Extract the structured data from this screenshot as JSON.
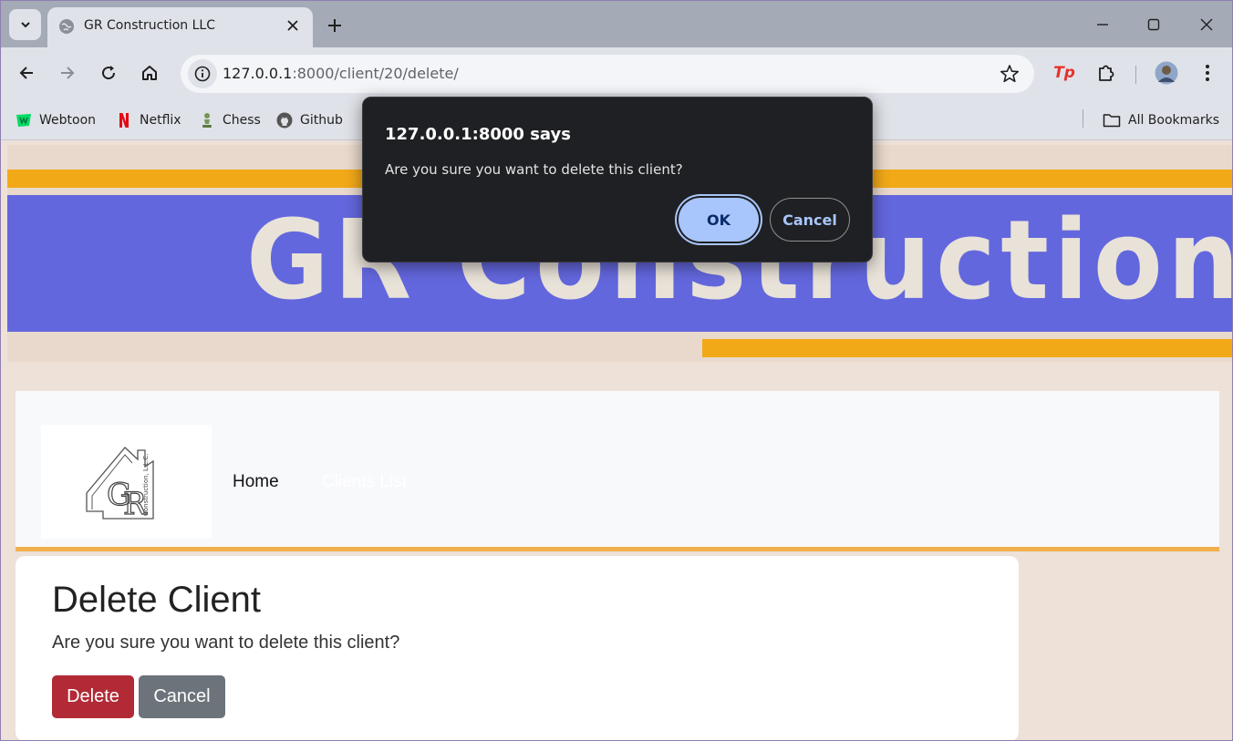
{
  "browser": {
    "tab_title": "GR Construction LLC",
    "url_host": "127.0.0.1",
    "url_rest": ":8000/client/20/delete/",
    "bookmarks": [
      {
        "label": "Webtoon",
        "icon": "webtoon-icon",
        "color": "#00dc64"
      },
      {
        "label": "Netflix",
        "icon": "netflix-icon",
        "color": "#e50914"
      },
      {
        "label": "Chess",
        "icon": "chess-icon",
        "color": "#769656"
      },
      {
        "label": "Github",
        "icon": "github-icon",
        "color": "#444444"
      }
    ],
    "all_bookmarks_label": "All Bookmarks"
  },
  "banner": {
    "text": "GR Construction, L.L.C."
  },
  "nav": {
    "home_label": "Home",
    "clients_label": "Clients List"
  },
  "card": {
    "title": "Delete Client",
    "message": "Are you sure you want to delete this client?",
    "delete_label": "Delete",
    "cancel_label": "Cancel"
  },
  "dialog": {
    "title": "127.0.0.1:8000 says",
    "message": "Are you sure you want to delete this client?",
    "ok_label": "OK",
    "cancel_label": "Cancel"
  },
  "colors": {
    "accent": "#efb04d",
    "delete": "#b12a35",
    "cancel": "#6c737b",
    "dialog_bg": "#1f2023",
    "dialog_ok": "#a8c6fb"
  }
}
